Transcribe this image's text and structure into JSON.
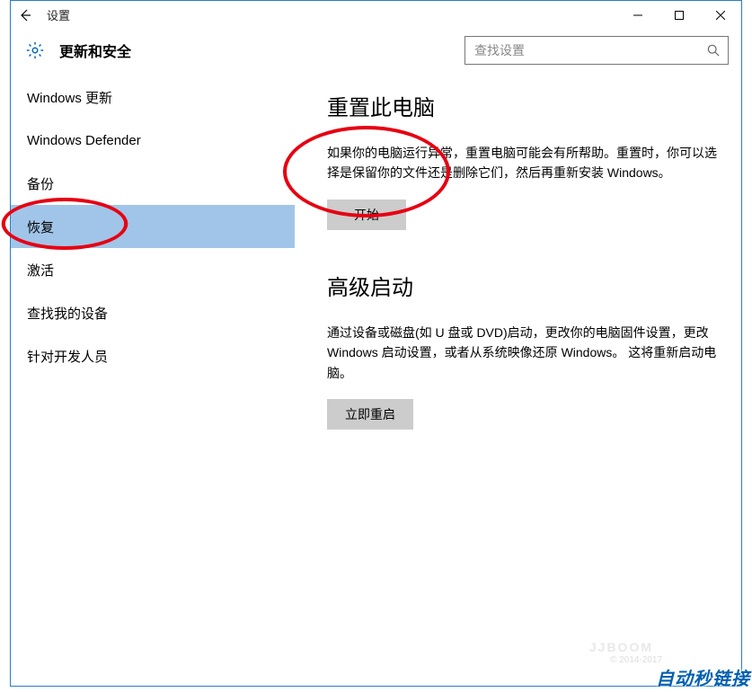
{
  "titlebar": {
    "title": "设置"
  },
  "header": {
    "category": "更新和安全",
    "search_placeholder": "查找设置"
  },
  "sidebar": {
    "items": [
      "Windows 更新",
      "Windows Defender",
      "备份",
      "恢复",
      "激活",
      "查找我的设备",
      "针对开发人员"
    ],
    "selected_index": 3
  },
  "content": {
    "sections": [
      {
        "title": "重置此电脑",
        "desc": "如果你的电脑运行异常，重置电脑可能会有所帮助。重置时，你可以选择是保留你的文件还是删除它们，然后再重新安装 Windows。",
        "button": "开始"
      },
      {
        "title": "高级启动",
        "desc": "通过设备或磁盘(如 U 盘或 DVD)启动，更改你的电脑固件设置，更改 Windows 启动设置，或者从系统映像还原 Windows。 这将重新启动电脑。",
        "button": "立即重启"
      }
    ]
  },
  "watermark": "自动秒链接"
}
